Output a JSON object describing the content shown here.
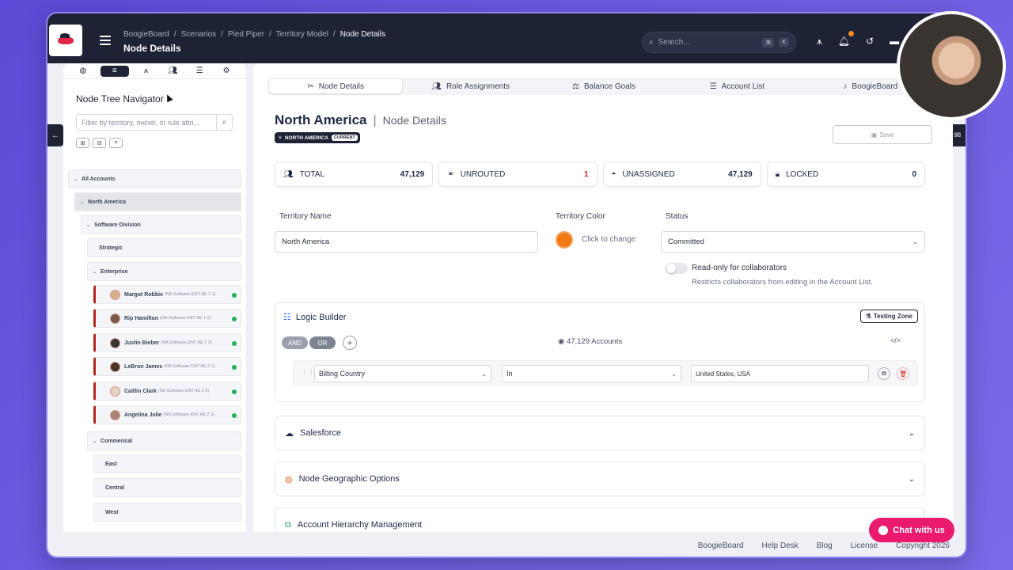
{
  "topbar": {
    "breadcrumbs": [
      "BoogieBoard",
      "Scenarios",
      "Pied Piper",
      "Territory Model",
      "Node Details"
    ],
    "title": "Node Details",
    "search_placeholder": "Search...",
    "kbd1": "⌘",
    "kbd2": "K"
  },
  "sidebar": {
    "title": "Node Tree Navigator",
    "filter_placeholder": "Filter by territory, owner, or rule attri...",
    "tree": {
      "all": "All Accounts",
      "na": "North America",
      "software": "Software Division",
      "strategic": "Strategic",
      "enterprise": "Enterprise",
      "people": [
        {
          "name": "Margot Robbie",
          "role": "(NA Software ENT AE 1 1)"
        },
        {
          "name": "Rip Hamilton",
          "role": "(NA Software ENT AE 1 2)"
        },
        {
          "name": "Justin Bieber",
          "role": "(NA Software ENT AE 1 3)"
        },
        {
          "name": "LeBron James",
          "role": "(NA Software ENT AE 2 1)"
        },
        {
          "name": "Caitlin Clark",
          "role": "(NA Software ENT AE 2 2)"
        },
        {
          "name": "Angelina Jolie",
          "role": "(NA Software ENT AE 2 3)"
        }
      ],
      "commercial": "Commerical",
      "east": "East",
      "central": "Central",
      "west": "West"
    }
  },
  "tabs": [
    "Node Details",
    "Role Assignments",
    "Balance Goals",
    "Account List",
    "BoogieBoard"
  ],
  "node": {
    "name": "North America",
    "subtitle": "Node Details",
    "pill_label": "NORTH AMERICA",
    "pill_badge": "CURRENT",
    "save_label": "Save"
  },
  "stats": [
    {
      "label": "TOTAL",
      "value": "47,129",
      "icon": "users-icon"
    },
    {
      "label": "UNROUTED",
      "value": "1",
      "icon": "binoculars-icon"
    },
    {
      "label": "UNASSIGNED",
      "value": "47,129",
      "icon": "ghost-icon"
    },
    {
      "label": "LOCKED",
      "value": "0",
      "icon": "lock-icon"
    }
  ],
  "form": {
    "territory_name_label": "Territory Name",
    "territory_name_value": "North America",
    "territory_color_label": "Territory Color",
    "color_hex": "#f07a14",
    "click_to_change": "Click to change",
    "status_label": "Status",
    "status_value": "Committed",
    "toggle_label": "Read-only for collaborators",
    "toggle_desc": "Restricts collaborators from editing in the Account List."
  },
  "logic": {
    "title": "Logic Builder",
    "testing_zone": "Testing Zone",
    "and": "AND",
    "or": "OR",
    "accounts": "47,129 Accounts",
    "field": "Billing Country",
    "operator": "In",
    "value": "United States, USA"
  },
  "sections": [
    "Salesforce",
    "Node Geographic Options",
    "Account Hierarchy Management"
  ],
  "footer": [
    "BoogieBoard",
    "Help Desk",
    "Blog",
    "License",
    "Copyright 2026"
  ],
  "chat": "Chat with us"
}
